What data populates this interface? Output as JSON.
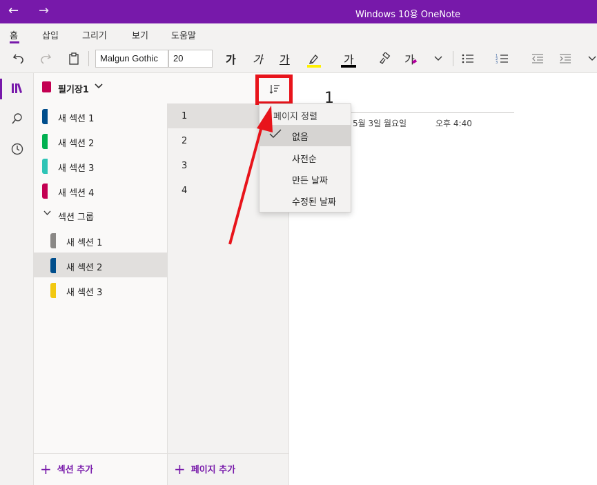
{
  "titlebar": {
    "title": "Windows 10용 OneNote",
    "back_icon": "←",
    "forward_icon": "→"
  },
  "menu": {
    "tabs": [
      "홈",
      "삽입",
      "그리기",
      "보기",
      "도움말"
    ],
    "active_tab": "홈"
  },
  "toolbar": {
    "font_name": "Malgun Gothic",
    "font_size": "20",
    "bold_label": "가",
    "italic_label": "가",
    "underline_label": "가",
    "font_color_label": "가",
    "clear_format_label": "가",
    "highlight_color": "#fff100",
    "font_color": "#000000"
  },
  "notebook": {
    "name": "필기장1"
  },
  "sections": [
    {
      "label": "새 섹션 1",
      "color": "#004e8c"
    },
    {
      "label": "새 섹션 2",
      "color": "#00b050"
    },
    {
      "label": "새 섹션 3",
      "color": "#2ec4b6"
    },
    {
      "label": "새 섹션 4",
      "color": "#c30052"
    }
  ],
  "section_group": {
    "label": "섹션 그룹",
    "items": [
      {
        "label": "새 섹션 1",
        "color": "#8a8886"
      },
      {
        "label": "새 섹션 2",
        "color": "#004e8c",
        "selected": true
      },
      {
        "label": "새 섹션 3",
        "color": "#f2c811"
      }
    ]
  },
  "pages": [
    "1",
    "2",
    "3",
    "4"
  ],
  "footer": {
    "add_section": "섹션 추가",
    "add_page": "페이지 추가"
  },
  "canvas": {
    "title": "1",
    "date": "5월 3일 월요일",
    "time": "오후 4:40"
  },
  "sort_menu": {
    "header": "페이지 정렬",
    "options": [
      "없음",
      "사전순",
      "만든 날짜",
      "수정된 날짜"
    ],
    "selected": "없음"
  },
  "colors": {
    "accent": "#7719aa",
    "annotation": "#e8141b"
  }
}
